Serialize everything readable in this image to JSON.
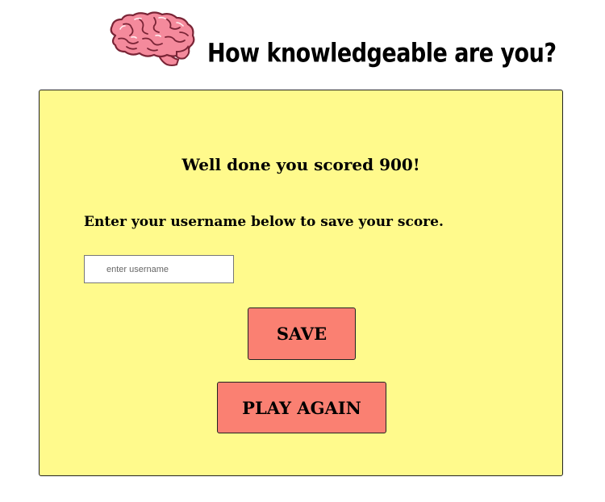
{
  "header": {
    "logo_icon": "brain-icon",
    "title": "How knowledgeable are you?"
  },
  "end_card": {
    "score_message": "Well done you scored 900!",
    "instructions": "Enter your username below to save your score.",
    "username_input": {
      "value": "",
      "placeholder": "enter username"
    },
    "save_label": "SAVE",
    "play_again_label": "PLAY AGAIN"
  },
  "colors": {
    "card_background": "#fffa8c",
    "button_background": "#fa8072",
    "brain_pink": "#f48a9c"
  }
}
